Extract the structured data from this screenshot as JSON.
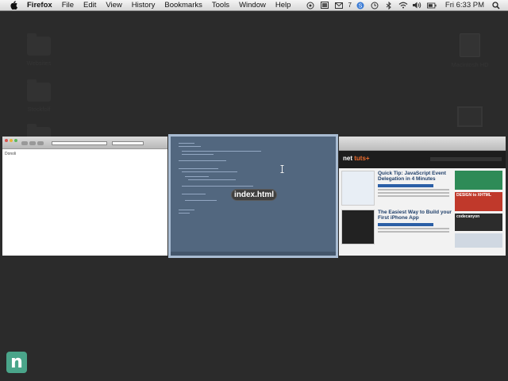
{
  "menubar": {
    "app_name": "Firefox",
    "items": [
      "File",
      "Edit",
      "View",
      "History",
      "Bookmarks",
      "Tools",
      "Window",
      "Help"
    ],
    "status": {
      "count": "7",
      "clock": "Fri 6:33 PM"
    }
  },
  "desktop": {
    "icons": [
      {
        "label": "Websites"
      },
      {
        "label": "Stockfolf"
      },
      {
        "label": "Macintosh HD"
      }
    ]
  },
  "windows": {
    "firefox_thumb": {
      "content_text": "Donoli"
    },
    "editor_thumb": {
      "title": "index.html"
    },
    "netuts_thumb": {
      "logo": "net",
      "logo_accent": "tuts+",
      "post1_title": "Quick Tip: JavaScript Event Delegation in 4 Minutes",
      "post2_title": "The Easiest Way to Build your First iPhone App",
      "ad1": "DESIGN to XHTML",
      "ad2": "codecanyon"
    }
  },
  "colors": {
    "badge": "#4aa58a",
    "selection_outline": "#a9bcd2"
  },
  "badge": {
    "letter": "n"
  }
}
